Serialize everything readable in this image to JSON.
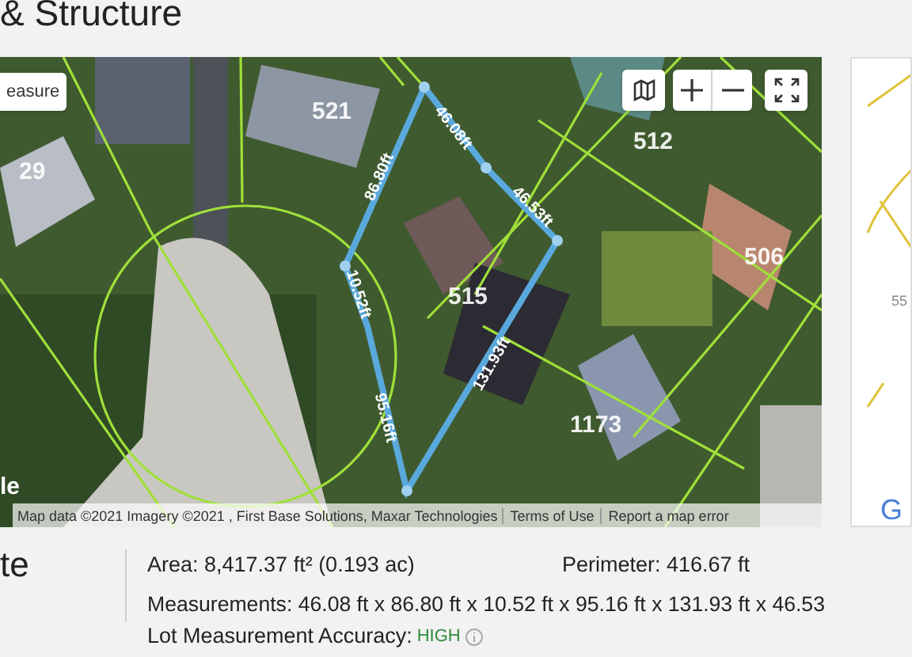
{
  "page_title": "& Structure",
  "map": {
    "measure_button": "easure",
    "controls": [
      {
        "kind": "map_type"
      },
      {
        "kind": "zoom_in"
      },
      {
        "kind": "zoom_out"
      },
      {
        "kind": "fullscreen"
      }
    ],
    "edge_labels": [
      "46.08ft",
      "86.80ft",
      "10.52ft",
      "95.16ft",
      "131.93ft",
      "46.53ft"
    ],
    "house_numbers": [
      "521",
      "29",
      "512",
      "515",
      "506",
      "1173"
    ],
    "logo": "le",
    "attribution": "Map data ©2021 Imagery ©2021 , First Base Solutions, Maxar Technologies",
    "links": [
      "Terms of Use",
      "Report a map error"
    ]
  },
  "side_map": {
    "label": "55",
    "logo": "G"
  },
  "section_heading": "te",
  "area": "Area: 8,417.37 ft² (0.193 ac)",
  "perimeter": "Perimeter: 416.67 ft",
  "measurements": "Measurements: 46.08 ft x 86.80 ft x 10.52 ft x 95.16 ft x 131.93 ft x 46.53",
  "accuracy": {
    "label": "Lot Measurement Accuracy:",
    "value": "HIGH"
  }
}
